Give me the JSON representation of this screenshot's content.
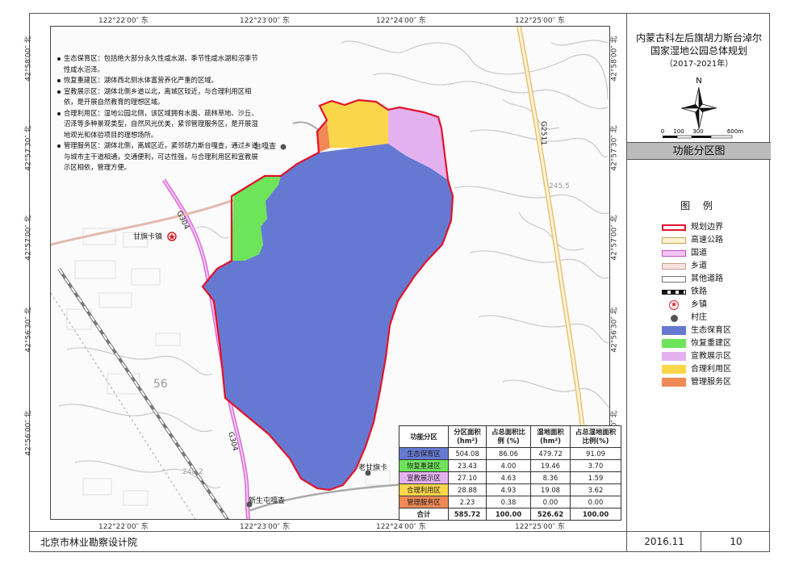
{
  "header": {
    "title_line1": "内蒙古科左后旗胡力斯台淖尔",
    "title_line2": "国家湿地公园总体规划",
    "title_line3": "（2017-2021年）",
    "section_title": "功能分区图"
  },
  "coords": {
    "top": [
      "122°22′00″ 东",
      "122°23′00″ 东",
      "122°24′00″ 东",
      "122°25′00″ 东"
    ],
    "bottom": [
      "122°22′00″ 东",
      "122°23′00″ 东",
      "122°24′00″ 东",
      "122°25′00″ 东"
    ],
    "left": [
      "42°58′00″ 北",
      "42°57′30″ 北",
      "42°57′00″ 北",
      "42°56′30″ 北",
      "42°56′00″ 北"
    ],
    "right": [
      "42°58′00″ 北",
      "42°57′30″ 北",
      "42°57′00″ 北",
      "42°56′30″ 北",
      "42°56′00″ 北"
    ]
  },
  "notes": [
    "生态保育区：包括绝大部分永久性咸水湖、季节性咸水湖和沼季节性咸水沼泽。",
    "恢复重建区：湖体西北侧水体富营养化严重的区域。",
    "宣教展示区：湖体北侧乡道以北，离城区较近，与合理利用区相依，是开展自然教育的理想区域。",
    "合理利用区：湿地公园北侧，该区域拥有水面、疏林草地、沙丘、沼泽等多种景观类型，自然风光优美，紧邻管理服务区，是开展湿地观光和体验项目的理想场所。",
    "管理服务区：湖体北侧，离城区近，紧邻胡力斯台嘎查，通过乡道与城市主干道相通，交通便利，可达性强，与合理利用区和宣教展示区相依，管理方便。"
  ],
  "places": {
    "village1": "台嘎查",
    "town": "甘旗卡镇",
    "village2": "老甘旗卡",
    "village3": "新生屯嘎查",
    "road_g304_a": "G304",
    "road_g304_b": "G304",
    "road_g2511": "G2511",
    "grid_label_56": "56",
    "elev_a": "245.5",
    "elev_b": "248.2"
  },
  "compass": {
    "north": "N",
    "scale_labels": [
      "0",
      "100",
      "300",
      "600m"
    ]
  },
  "table": {
    "headers": [
      "功能分区",
      "分区面积(hm²)",
      "占总面积比例 (%)",
      "湿地面积(hm²)",
      "占总湿地面积比例(%)"
    ],
    "rows": [
      {
        "name": "生态保育区",
        "color": "#6679d2",
        "area": "504.08",
        "ratio": "86.06",
        "wet": "479.72",
        "wet_ratio": "91.09"
      },
      {
        "name": "恢复重建区",
        "color": "#6ee45a",
        "area": "23.43",
        "ratio": "4.00",
        "wet": "19.46",
        "wet_ratio": "3.70"
      },
      {
        "name": "宣教展示区",
        "color": "#e4b1ef",
        "area": "27.10",
        "ratio": "4.63",
        "wet": "8.36",
        "wet_ratio": "1.59"
      },
      {
        "name": "合理利用区",
        "color": "#fad64a",
        "area": "28.88",
        "ratio": "4.93",
        "wet": "19.08",
        "wet_ratio": "3.62"
      },
      {
        "name": "管理服务区",
        "color": "#f08a55",
        "area": "2.23",
        "ratio": "0.38",
        "wet": "0.00",
        "wet_ratio": "0.00"
      }
    ],
    "total": {
      "name": "合计",
      "area": "585.72",
      "ratio": "100.00",
      "wet": "526.62",
      "wet_ratio": "100.00"
    }
  },
  "legend": {
    "heading": "图 例",
    "items": [
      {
        "label": "规划边界",
        "type": "boundary"
      },
      {
        "label": "高速公路",
        "type": "highway"
      },
      {
        "label": "国道",
        "type": "national"
      },
      {
        "label": "乡道",
        "type": "township"
      },
      {
        "label": "其他道路",
        "type": "other"
      },
      {
        "label": "铁路",
        "type": "rail"
      },
      {
        "label": "乡镇",
        "type": "town"
      },
      {
        "label": "村庄",
        "type": "village"
      },
      {
        "label": "生态保育区",
        "type": "fill",
        "color": "#6679d2"
      },
      {
        "label": "恢复重建区",
        "type": "fill",
        "color": "#6ee45a"
      },
      {
        "label": "宣教展示区",
        "type": "fill",
        "color": "#e4b1ef"
      },
      {
        "label": "合理利用区",
        "type": "fill",
        "color": "#fad64a"
      },
      {
        "label": "管理服务区",
        "type": "fill",
        "color": "#f08a55"
      }
    ]
  },
  "footer": {
    "org": "北京市林业勘察设计院",
    "date": "2016.11",
    "page": "10"
  }
}
